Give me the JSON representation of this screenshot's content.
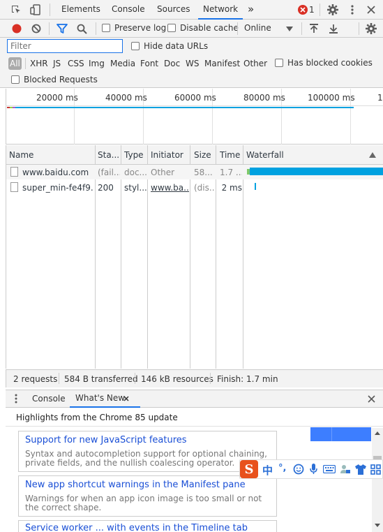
{
  "colors": {
    "accent": "#1a73e8",
    "record": "#d93025",
    "waterfall_bar": "#00a1e0",
    "error": "#d93025",
    "ime_orange": "#e8511c"
  },
  "top_tabs": [
    "Elements",
    "Console",
    "Sources",
    "Network"
  ],
  "more_tabs_glyph": "»",
  "error_count": "1",
  "toolbar": {
    "preserve_log": "Preserve log",
    "disable_cache": "Disable cache",
    "throttling": "Online"
  },
  "filter": {
    "placeholder": "Filter",
    "hide_data_urls": "Hide data URLs",
    "has_blocked_cookies": "Has blocked cookies",
    "blocked_requests": "Blocked Requests",
    "types": [
      "All",
      "XHR",
      "JS",
      "CSS",
      "Img",
      "Media",
      "Font",
      "Doc",
      "WS",
      "Manifest",
      "Other"
    ]
  },
  "overview": {
    "ticks": [
      "20000 ms",
      "40000 ms",
      "60000 ms",
      "80000 ms",
      "100000 ms",
      "1"
    ]
  },
  "table": {
    "headers": [
      "Name",
      "Sta...",
      "Type",
      "Initiator",
      "Size",
      "Time",
      "Waterfall"
    ],
    "rows": [
      {
        "name": "www.baidu.com",
        "status": "(fail...",
        "type": "doc...",
        "initiator": "Other",
        "size": "58...",
        "time": "1.7 ..."
      },
      {
        "name": "super_min-fe4f9...",
        "status": "200",
        "type": "styl...",
        "initiator": "www.ba...",
        "size": "(dis...",
        "time": "2 ms"
      }
    ]
  },
  "status": {
    "requests": "2 requests",
    "transferred": "584 B transferred",
    "resources": "146 kB resources",
    "finish": "Finish: 1.7 min"
  },
  "drawer": {
    "tabs": [
      "Console",
      "What's New"
    ],
    "highlights": "Highlights from the Chrome 85 update",
    "cards": [
      {
        "title": "Support for new JavaScript features",
        "desc": "Syntax and autocompletion support for optional chaining, private fields, and the nullish coalescing operator."
      },
      {
        "title": "New app shortcut warnings in the Manifest pane",
        "desc": "Warnings for when an app icon image is too small or not the correct shape."
      },
      {
        "title": "Service worker ... with events in the Timeline tab",
        "desc": ""
      }
    ]
  },
  "ime": {
    "logo": "S",
    "lang": "中",
    "punct": "°,"
  }
}
